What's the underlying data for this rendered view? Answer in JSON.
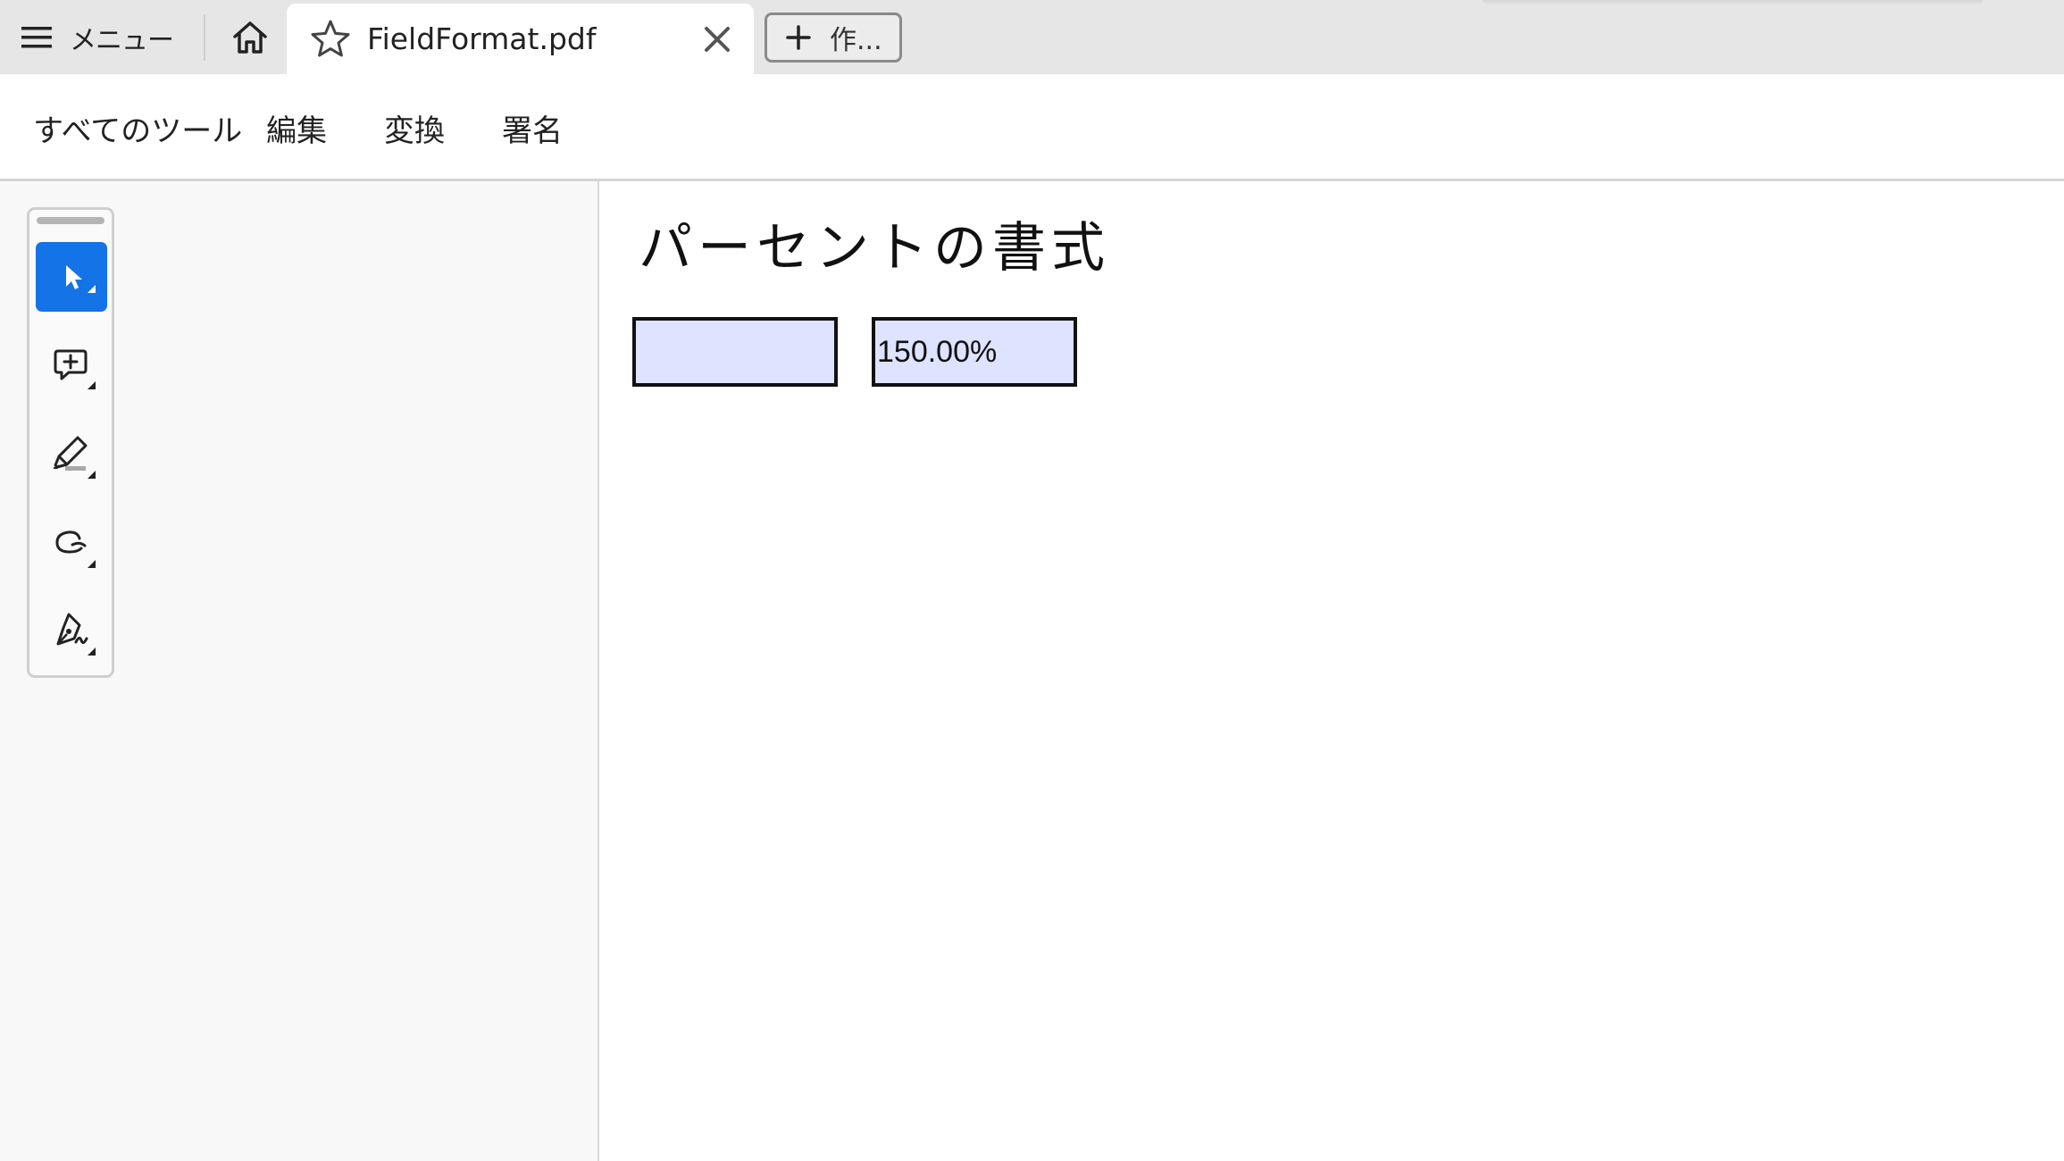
{
  "tabbar": {
    "menu_label": "メニュー",
    "doc_tab_title": "FieldFormat.pdf",
    "new_tab_label": "作..."
  },
  "menubar": {
    "items": [
      {
        "label": "すべてのツール"
      },
      {
        "label": "編集"
      },
      {
        "label": "変換"
      },
      {
        "label": "署名"
      }
    ]
  },
  "toolbox": {
    "tools": [
      {
        "icon": "cursor-icon",
        "active": true
      },
      {
        "icon": "add-comment-icon",
        "active": false
      },
      {
        "icon": "highlighter-icon",
        "active": false
      },
      {
        "icon": "freehand-icon",
        "active": false
      },
      {
        "icon": "signature-pen-icon",
        "active": false
      }
    ]
  },
  "document": {
    "heading": "パーセントの書式",
    "fields": [
      {
        "value": ""
      },
      {
        "value": "150.00%"
      }
    ]
  },
  "colors": {
    "accent": "#1473e6",
    "field_fill": "#dee3ff",
    "tabbar_bg": "#e6e6e6",
    "panel_bg": "#f8f8f8"
  }
}
